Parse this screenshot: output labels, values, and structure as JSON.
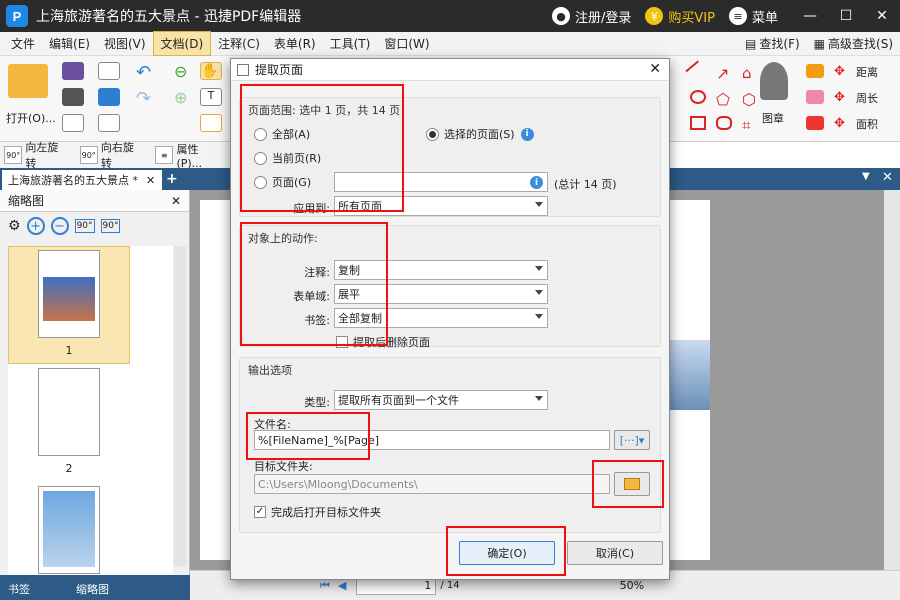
{
  "window": {
    "title": "上海旅游著名的五大景点 - 迅捷PDF编辑器",
    "login": "注册/登录",
    "vip": "购买VIP",
    "menu": "菜单"
  },
  "menubar": {
    "items": [
      "文件",
      "编辑(E)",
      "视图(V)",
      "文档(D)",
      "注释(C)",
      "表单(R)",
      "工具(T)",
      "窗口(W)"
    ],
    "find": "查找(F)",
    "advanced_find": "高级查找(S)"
  },
  "ribbon": {
    "open": "打开(O)...",
    "stamp": "图章",
    "distance": "距离",
    "perimeter": "周长",
    "area": "面积"
  },
  "toolbar2": {
    "rotate_left": "向左旋转",
    "rotate_right": "向右旋转",
    "properties": "属性(P)..."
  },
  "tabs": {
    "doc_tab": "上海旅游著名的五大景点 *"
  },
  "leftpanel": {
    "title": "缩略图",
    "page1": "1",
    "page2": "2",
    "tab_bookmarks": "书签",
    "tab_thumbs": "缩略图"
  },
  "status": {
    "page": "1",
    "total": "/ 14",
    "zoom": "50%"
  },
  "dialog": {
    "title": "提取页面",
    "range_group": "页面范围: 选中 1 页，共 14 页",
    "opt_all": "全部(A)",
    "opt_current": "当前页(R)",
    "opt_pages": "页面(G)",
    "opt_selected": "选择的页面(S)",
    "pages_value": "",
    "total_hint": "(总计 14 页)",
    "apply_to_label": "应用到:",
    "apply_to_value": "所有页面",
    "actions_group": "对象上的动作:",
    "annot_label": "注释:",
    "annot_value": "复制",
    "form_label": "表单域:",
    "form_value": "展平",
    "bookmark_label": "书签:",
    "bookmark_value": "全部复制",
    "delete_after": "提取后删除页面",
    "output_group": "输出选项",
    "type_label": "类型:",
    "type_value": "提取所有页面到一个文件",
    "filename_label": "文件名:",
    "filename_value": "%[FileName]_%[Page]",
    "target_label": "目标文件夹:",
    "target_value": "C:\\Users\\Mloong\\Documents\\",
    "open_after": "完成后打开目标文件夹",
    "ok": "确定(O)",
    "cancel": "取消(C)"
  },
  "colors": {
    "titlebar": "#2b2b2b",
    "tabstrip": "#2d5a86",
    "highlight": "#ff1111"
  }
}
